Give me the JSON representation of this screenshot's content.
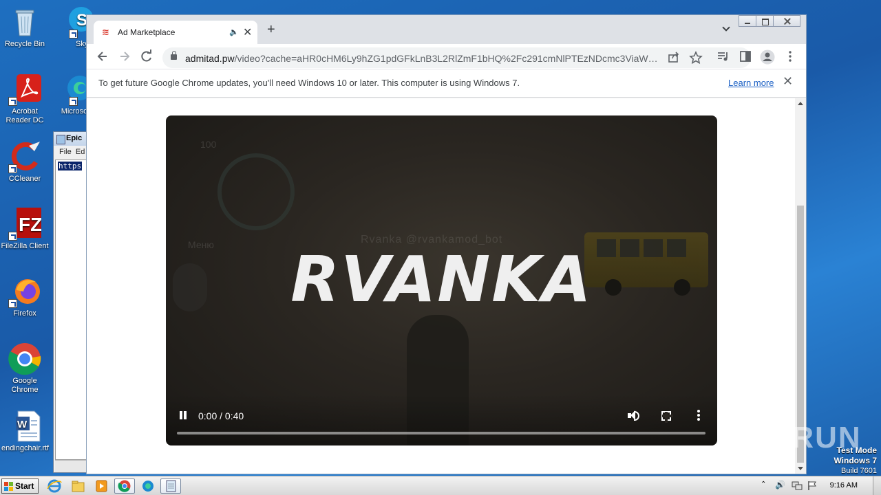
{
  "desktop": {
    "icons": [
      {
        "label": "Recycle Bin"
      },
      {
        "label": "Skype"
      },
      {
        "label": "Acrobat Reader DC"
      },
      {
        "label": "Microsoft"
      },
      {
        "label": "CCleaner"
      },
      {
        "label": "FileZilla Client"
      },
      {
        "label": "Firefox"
      },
      {
        "label": "Google Chrome"
      },
      {
        "label": "endingchair.rtf"
      }
    ],
    "notepad": {
      "title": "Epic",
      "menu_file": "File",
      "menu_edit": "Ed",
      "selected_text": "https"
    }
  },
  "browser": {
    "tab": {
      "title": "Ad Marketplace",
      "favicon": "≋",
      "audio_icon": "🔈",
      "close": "✕"
    },
    "new_tab": "+",
    "url_domain": "admitad.pw",
    "url_path": "/video?cache=aHR0cHM6Ly9hZG1pdGFkLnB3L2RlZmF1bHQ%2Fc291cmNlPTEzNDcmc3ViaWQ9TF...",
    "infobar": {
      "message": "To get future Google Chrome updates, you'll need Windows 10 or later. This computer is using Windows 7.",
      "link": "Learn more"
    },
    "video": {
      "title_overlay": "RVANKA",
      "faint_text": "Rvanka @rvankamod_bot",
      "faint_hud": "100",
      "faint_menu": "Меню",
      "time": "0:00 / 0:40",
      "progress_fraction": 0.0
    }
  },
  "taskbar": {
    "start_label": "Start",
    "clock": "9:16 AM"
  },
  "overlay": {
    "watermark": "ANY RUN",
    "test_mode": "Test Mode",
    "os": "Windows 7",
    "build": "Build 7601"
  }
}
